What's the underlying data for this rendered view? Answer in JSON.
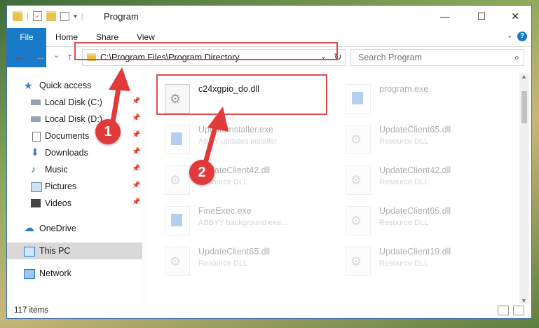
{
  "window": {
    "title": "Program",
    "controls": {
      "minimize": "—",
      "maximize": "☐",
      "close": "✕"
    }
  },
  "ribbon": {
    "tabs": [
      {
        "label": "File"
      },
      {
        "label": "Home"
      },
      {
        "label": "Share"
      },
      {
        "label": "View"
      }
    ],
    "help_label": "?"
  },
  "navigation": {
    "back": "←",
    "forward": "→",
    "recent": "⌄",
    "up": "↑",
    "address": "C:\\Program Files\\Program Directory",
    "search_placeholder": "Search Program"
  },
  "sidebar": {
    "items": [
      {
        "label": "Quick access",
        "icon": "star-icon"
      },
      {
        "label": "Local Disk (C:)",
        "icon": "drive-icon"
      },
      {
        "label": "Local Disk (D:)",
        "icon": "drive-icon"
      },
      {
        "label": "Documents",
        "icon": "documents-icon"
      },
      {
        "label": "Downloads",
        "icon": "download-icon"
      },
      {
        "label": "Music",
        "icon": "music-icon"
      },
      {
        "label": "Pictures",
        "icon": "pictures-icon"
      },
      {
        "label": "Videos",
        "icon": "videos-icon"
      },
      {
        "label": "OneDrive",
        "icon": "cloud-icon"
      },
      {
        "label": "This PC",
        "icon": "computer-icon"
      },
      {
        "label": "Network",
        "icon": "network-icon"
      }
    ]
  },
  "files": [
    {
      "name": "c24xgpio_do.dll",
      "desc": "",
      "type": "dll"
    },
    {
      "name": "program.exe",
      "desc": "",
      "type": "exe"
    },
    {
      "name": "UpdateInstaller.exe",
      "desc": "ABBY updates installer",
      "type": "exe"
    },
    {
      "name": "UpdateClient65.dll",
      "desc": "Resource DLL",
      "type": "dll"
    },
    {
      "name": "UpdateClient42.dll",
      "desc": "Resource DLL",
      "type": "dll"
    },
    {
      "name": "UpdateClient42.dll",
      "desc": "Resource DLL",
      "type": "dll"
    },
    {
      "name": "FineExec.exe",
      "desc": "ABBYY background exe...",
      "type": "exe"
    },
    {
      "name": "UpdateClient65.dll",
      "desc": "Resource DLL",
      "type": "dll"
    },
    {
      "name": "UpdateClient65.dll",
      "desc": "Resource DLL",
      "type": "dll"
    },
    {
      "name": "UpdateClient19.dll",
      "desc": "Resource DLL",
      "type": "dll"
    }
  ],
  "status": {
    "item_count": "117 items"
  },
  "annotations": {
    "marker1": "1",
    "marker2": "2"
  },
  "colors": {
    "accent": "#1979ca",
    "highlight": "#e04a4a"
  }
}
